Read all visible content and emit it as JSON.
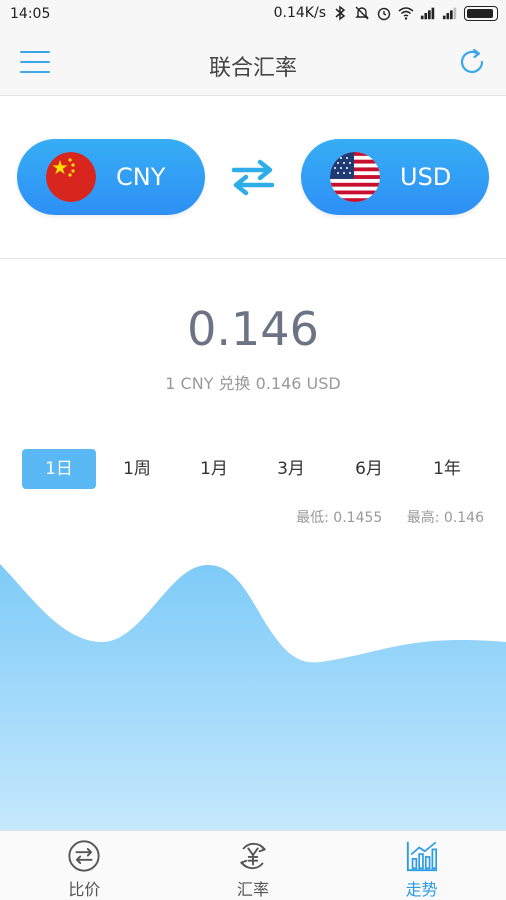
{
  "status_bar": {
    "time": "14:05",
    "network_speed": "0.14K/s"
  },
  "header": {
    "title": "联合汇率",
    "menu_icon": "menu-icon",
    "refresh_icon": "refresh-icon"
  },
  "currency": {
    "from_code": "CNY",
    "to_code": "USD",
    "swap_icon": "swap-arrows-icon"
  },
  "rate": {
    "value": "0.146",
    "description": "1  CNY 兑换 0.146  USD"
  },
  "periods": [
    "1日",
    "1周",
    "1月",
    "3月",
    "6月",
    "1年"
  ],
  "selected_period": "1日",
  "range": {
    "low_label": "最低: 0.1455",
    "high_label": "最高: 0.146"
  },
  "chart_data": {
    "type": "area",
    "ylim": [
      0.1455,
      0.146
    ],
    "colors": {
      "top": "#7ecbf8",
      "bottom": "#c5e8fc"
    }
  },
  "bottom_nav": {
    "items": [
      {
        "label": "比价",
        "icon": "compare-icon"
      },
      {
        "label": "汇率",
        "icon": "yen-exchange-icon"
      },
      {
        "label": "走势",
        "icon": "trend-chart-icon"
      }
    ],
    "active_index": 2
  },
  "colors": {
    "accent": "#2b9be5",
    "button": "#2d8ff5"
  }
}
